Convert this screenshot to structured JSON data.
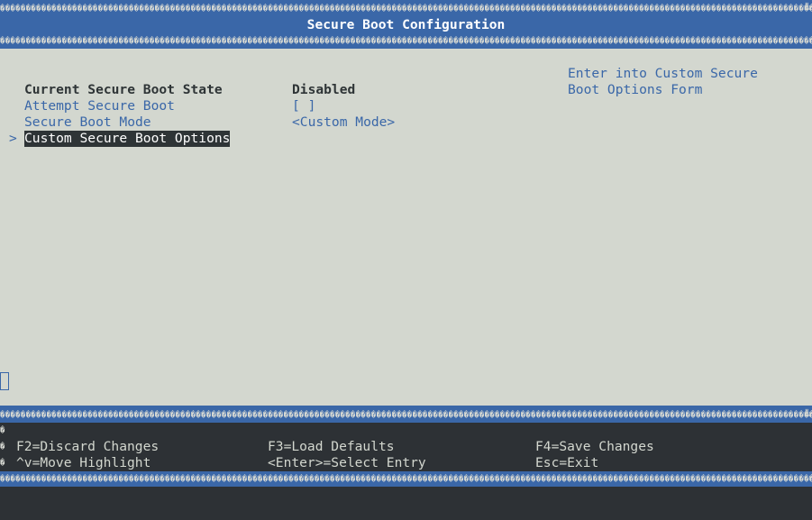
{
  "header": {
    "title": "Secure Boot Configuration",
    "border_char": "�",
    "corner_char": "╙"
  },
  "items": [
    {
      "label": "Current Secure Boot State",
      "value": "Disabled"
    },
    {
      "label": "Attempt Secure Boot",
      "value": "[ ]"
    },
    {
      "label": "Secure Boot Mode",
      "value": "<Custom Mode>"
    },
    {
      "label": "Custom Secure Boot Options",
      "value": "",
      "pointer": ">"
    }
  ],
  "help": {
    "line1": "Enter into Custom Secure",
    "line2": "Boot Options Form"
  },
  "footer": {
    "discard": "F2=Discard Changes",
    "load_defaults": "F3=Load Defaults",
    "save": "F4=Save Changes",
    "move": "^v=Move Highlight",
    "select": "<Enter>=Select Entry",
    "exit": "Esc=Exit"
  },
  "colors": {
    "accent": "#3a67a8",
    "panel": "#d3d7cf",
    "dark": "#2d3135"
  }
}
